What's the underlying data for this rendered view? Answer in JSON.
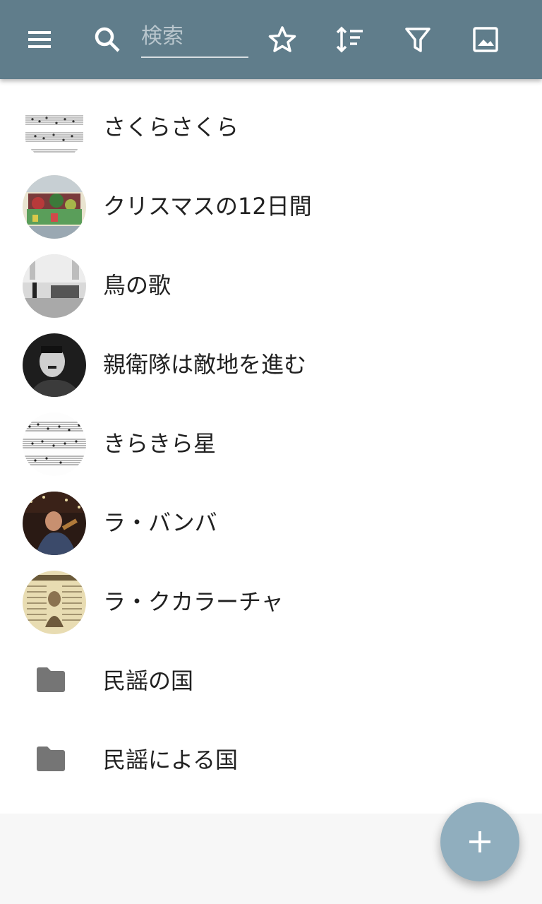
{
  "toolbar": {
    "menu_icon": "menu-icon",
    "search_icon": "search-icon",
    "search": {
      "placeholder": "検索",
      "value": ""
    },
    "actions": [
      "star-icon",
      "sort-icon",
      "filter-icon",
      "image-icon"
    ],
    "colors": {
      "background": "#607d8b",
      "icon": "#ffffff"
    }
  },
  "list": {
    "items": [
      {
        "label": "さくらさくら",
        "type": "song"
      },
      {
        "label": "クリスマスの12日間",
        "type": "song"
      },
      {
        "label": "鳥の歌",
        "type": "song"
      },
      {
        "label": "親衛隊は敵地を進む",
        "type": "song"
      },
      {
        "label": "きらきら星",
        "type": "song"
      },
      {
        "label": "ラ・バンバ",
        "type": "song"
      },
      {
        "label": "ラ・クカラーチャ",
        "type": "song"
      },
      {
        "label": "民謡の国",
        "type": "folder"
      },
      {
        "label": "民謡による国",
        "type": "folder"
      }
    ]
  },
  "fab": {
    "icon": "plus-icon",
    "color": "#90aebe"
  }
}
